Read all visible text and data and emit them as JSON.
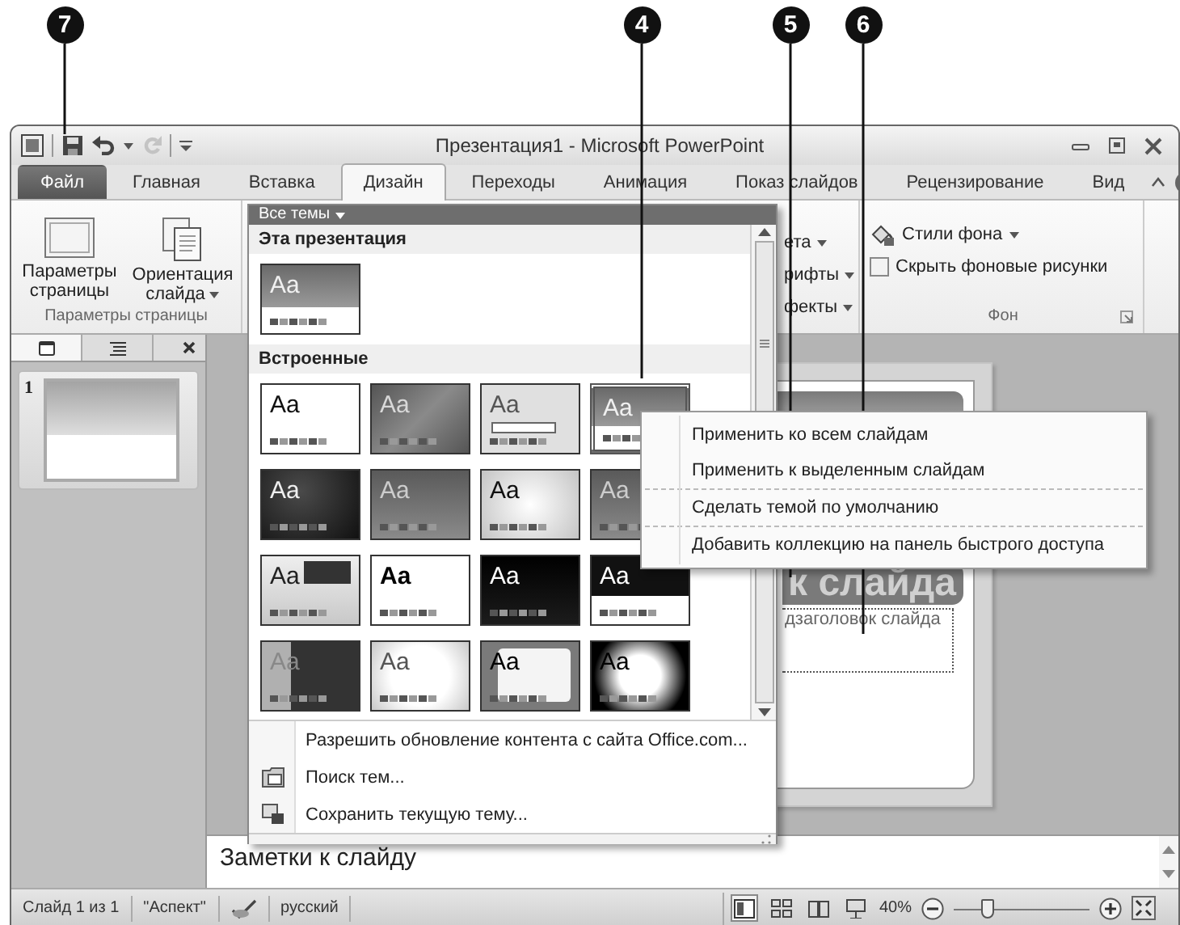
{
  "callouts": [
    {
      "label": "7"
    },
    {
      "label": "4"
    },
    {
      "label": "5"
    },
    {
      "label": "6"
    }
  ],
  "window": {
    "title": "Презентация1 - Microsoft PowerPoint"
  },
  "quick_access": [
    {
      "kind": "save",
      "disabled": false
    },
    {
      "kind": "undo",
      "disabled": false
    },
    {
      "kind": "redo",
      "disabled": true
    }
  ],
  "tabs": [
    {
      "label": "Файл",
      "kind": "file",
      "selected": false
    },
    {
      "label": "Главная",
      "kind": "tab",
      "selected": false
    },
    {
      "label": "Вставка",
      "kind": "tab",
      "selected": false
    },
    {
      "label": "Дизайн",
      "kind": "tab",
      "selected": true
    },
    {
      "label": "Переходы",
      "kind": "tab",
      "selected": false
    },
    {
      "label": "Анимация",
      "kind": "tab",
      "selected": false
    },
    {
      "label": "Показ слайдов",
      "kind": "tab",
      "selected": false
    },
    {
      "label": "Рецензирование",
      "kind": "tab",
      "selected": false
    },
    {
      "label": "Вид",
      "kind": "tab",
      "selected": false
    }
  ],
  "ribbon": {
    "page_setup": {
      "buttons": [
        {
          "label": "Параметры страницы",
          "kind": "page"
        },
        {
          "label": "Ориентация слайда",
          "kind": "orientation"
        }
      ],
      "group_label": "Параметры страницы"
    },
    "theme_options": [
      "ета",
      "рифты",
      "фекты"
    ],
    "background": {
      "styles_button": "Стили фона",
      "hide_graphics": {
        "label": "Скрыть фоновые рисунки",
        "checked": false
      },
      "group_label": "Фон"
    }
  },
  "slides_pane": {
    "tabs": [
      {
        "kind": "slides",
        "selected": true
      },
      {
        "kind": "outline",
        "selected": false
      }
    ],
    "slides": [
      {
        "number": "1",
        "selected": true
      }
    ]
  },
  "slide": {
    "title": "к слайда",
    "subtitle": "дзаголовок слайда"
  },
  "notes": {
    "text": "Заметки к слайду"
  },
  "status_bar": {
    "slide": "Слайд 1 из 1",
    "theme": "\"Аспект\"",
    "language": "русский",
    "views": [
      {
        "kind": "normal",
        "selected": true
      },
      {
        "kind": "sorter",
        "selected": false
      },
      {
        "kind": "reading",
        "selected": false
      },
      {
        "kind": "slideshow",
        "selected": false
      }
    ],
    "zoom": "40%",
    "zoom_slider": {
      "level": 0.25
    }
  },
  "theme_gallery": {
    "header": "Все темы",
    "sections": [
      {
        "title": "Эта презентация",
        "themes": [
          {
            "sample": "Aa",
            "kind": "current",
            "selected": false
          }
        ]
      },
      {
        "title": "Встроенные",
        "themes": [
          {
            "sample": "Aa",
            "kind": "white",
            "selected": false
          },
          {
            "sample": "Aa",
            "kind": "slate",
            "selected": false
          },
          {
            "sample": "Aa",
            "kind": "silver",
            "selected": false
          },
          {
            "sample": "Aa",
            "kind": "current",
            "selected": true
          },
          {
            "sample": "Aa",
            "kind": "night",
            "selected": false
          },
          {
            "sample": "Aa",
            "kind": "smoke",
            "selected": false
          },
          {
            "sample": "Aa",
            "kind": "paper",
            "selected": false
          },
          {
            "sample": "Aa",
            "kind": "smoke",
            "selected": false
          },
          {
            "sample": "Aa",
            "kind": "banner",
            "selected": false
          },
          {
            "sample": "Aa",
            "kind": "bold",
            "selected": false
          },
          {
            "sample": "Aa",
            "kind": "black",
            "selected": false
          },
          {
            "sample": "Aa",
            "kind": "band",
            "selected": false
          },
          {
            "sample": "Aa",
            "kind": "split",
            "selected": false
          },
          {
            "sample": "Aa",
            "kind": "soft",
            "selected": false
          },
          {
            "sample": "Aa",
            "kind": "card",
            "selected": false
          },
          {
            "sample": "Aa",
            "kind": "torn",
            "selected": false
          }
        ]
      }
    ],
    "actions": [
      {
        "label": "Разрешить обновление контента с сайта Office.com...",
        "kind": "update"
      },
      {
        "label": "Поиск тем...",
        "kind": "browse"
      },
      {
        "label": "Сохранить текущую тему...",
        "kind": "save"
      }
    ]
  },
  "context_menu": {
    "items": [
      {
        "label": "Применить ко всем слайдам",
        "separator_before": false
      },
      {
        "label": "Применить к выделенным слайдам",
        "separator_before": false
      },
      {
        "label": "Сделать темой по умолчанию",
        "separator_before": true
      },
      {
        "label": "Добавить коллекцию на панель быстрого доступа",
        "separator_before": true
      }
    ]
  }
}
